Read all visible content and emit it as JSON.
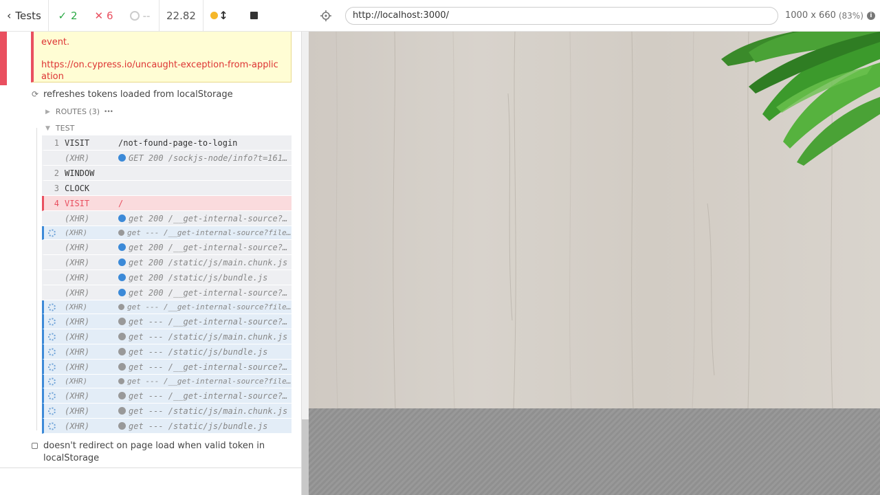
{
  "header": {
    "tests_label": "Tests",
    "passed": "2",
    "failed": "6",
    "pending": "--",
    "duration": "22.82"
  },
  "error": {
    "line": "event.",
    "link": "https://on.cypress.io/uncaught-exception-from-application"
  },
  "test": {
    "title": "refreshes tokens loaded from localStorage",
    "routes_label": "ROUTES (3)",
    "routes_more": "•••",
    "test_label": "TEST"
  },
  "commands": [
    {
      "num": "1",
      "name": "VISIT",
      "msg": "/not-found-page-to-login",
      "kind": "normal"
    },
    {
      "num": "",
      "name": "(XHR)",
      "msg": "GET 200 /sockjs-node/info?t=161...",
      "kind": "xhr",
      "dot": "#3c8ad8"
    },
    {
      "num": "2",
      "name": "WINDOW",
      "msg": "",
      "kind": "normal"
    },
    {
      "num": "3",
      "name": "CLOCK",
      "msg": "",
      "kind": "normal"
    },
    {
      "num": "4",
      "name": "VISIT",
      "msg": "/",
      "kind": "failed"
    },
    {
      "num": "",
      "name": "(XHR)",
      "msg": "get 200 /__get-internal-source?...",
      "kind": "xhr",
      "dot": "#3c8ad8"
    },
    {
      "num": "",
      "name": "(XHR)",
      "msg": "get --- /__get-internal-source?fileNa...",
      "kind": "xhr pending dup",
      "dot": "#999"
    },
    {
      "num": "",
      "name": "(XHR)",
      "msg": "get 200 /__get-internal-source?...",
      "kind": "xhr",
      "dot": "#3c8ad8"
    },
    {
      "num": "",
      "name": "(XHR)",
      "msg": "get 200 /static/js/main.chunk.js",
      "kind": "xhr",
      "dot": "#3c8ad8"
    },
    {
      "num": "",
      "name": "(XHR)",
      "msg": "get 200 /static/js/bundle.js",
      "kind": "xhr",
      "dot": "#3c8ad8"
    },
    {
      "num": "",
      "name": "(XHR)",
      "msg": "get 200 /__get-internal-source?...",
      "kind": "xhr",
      "dot": "#3c8ad8"
    },
    {
      "num": "",
      "name": "(XHR)",
      "msg": "get --- /__get-internal-source?fileNa...",
      "kind": "xhr pending dup",
      "dot": "#999"
    },
    {
      "num": "",
      "name": "(XHR)",
      "msg": "get --- /__get-internal-source?...",
      "kind": "xhr pending",
      "dot": "#999"
    },
    {
      "num": "",
      "name": "(XHR)",
      "msg": "get --- /static/js/main.chunk.js",
      "kind": "xhr pending",
      "dot": "#999"
    },
    {
      "num": "",
      "name": "(XHR)",
      "msg": "get --- /static/js/bundle.js",
      "kind": "xhr pending",
      "dot": "#999"
    },
    {
      "num": "",
      "name": "(XHR)",
      "msg": "get --- /__get-internal-source?...",
      "kind": "xhr pending",
      "dot": "#999"
    },
    {
      "num": "",
      "name": "(XHR)",
      "msg": "get --- /__get-internal-source?fileNa...",
      "kind": "xhr pending dup",
      "dot": "#999"
    },
    {
      "num": "",
      "name": "(XHR)",
      "msg": "get --- /__get-internal-source?...",
      "kind": "xhr pending",
      "dot": "#999"
    },
    {
      "num": "",
      "name": "(XHR)",
      "msg": "get --- /static/js/main.chunk.js",
      "kind": "xhr pending",
      "dot": "#999"
    },
    {
      "num": "",
      "name": "(XHR)",
      "msg": "get --- /static/js/bundle.js",
      "kind": "xhr pending",
      "dot": "#999"
    }
  ],
  "next_test": {
    "title": "doesn't redirect on page load when valid token in localStorage"
  },
  "aut": {
    "url": "http://localhost:3000/",
    "viewport": "1000 x 660",
    "scale": "(83%)"
  },
  "colors": {
    "passed": "#2aa844",
    "failed": "#e94f5f",
    "pending_xhr": "#3c8ad8"
  }
}
